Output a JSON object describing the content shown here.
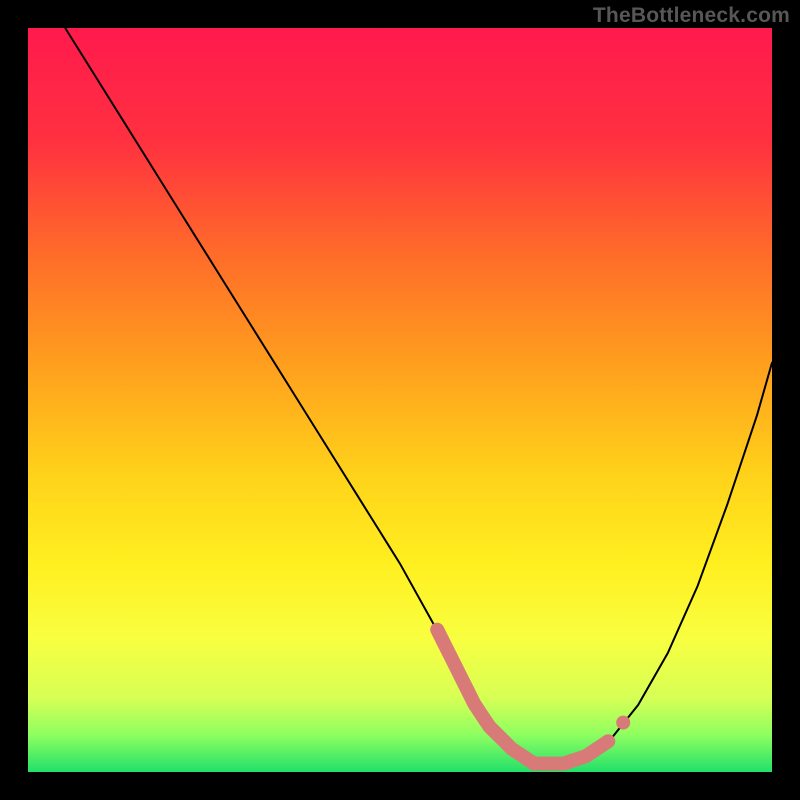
{
  "watermark": {
    "text": "TheBottleneck.com"
  },
  "chart_data": {
    "type": "line",
    "title": "",
    "xlabel": "",
    "ylabel": "",
    "xlim": [
      0,
      100
    ],
    "ylim": [
      0,
      100
    ],
    "grid": false,
    "legend": false,
    "series": [
      {
        "name": "bottleneck-curve",
        "x": [
          0,
          5,
          10,
          15,
          20,
          25,
          30,
          35,
          40,
          45,
          50,
          55,
          58,
          60,
          62,
          65,
          68,
          70,
          72,
          75,
          78,
          82,
          86,
          90,
          94,
          98,
          100
        ],
        "values": [
          108,
          100,
          92,
          84,
          76,
          68,
          60,
          52,
          44,
          36,
          28,
          19,
          13,
          9,
          6,
          3,
          1,
          1,
          1,
          2,
          4,
          9,
          16,
          25,
          36,
          48,
          55
        ],
        "color": "#000000"
      }
    ],
    "marker_band": {
      "comment": "thick pink band tracing the valley floor",
      "color": "#d87a78",
      "x_start": 55,
      "x_end": 78,
      "approx_y": 2,
      "detached_marker_x": 80
    },
    "background_gradient": {
      "stops": [
        {
          "pos": 0.0,
          "color": "#ff1a4d"
        },
        {
          "pos": 0.15,
          "color": "#ff3040"
        },
        {
          "pos": 0.3,
          "color": "#ff6a2a"
        },
        {
          "pos": 0.45,
          "color": "#ff9e1e"
        },
        {
          "pos": 0.6,
          "color": "#ffd21a"
        },
        {
          "pos": 0.72,
          "color": "#ffef20"
        },
        {
          "pos": 0.82,
          "color": "#f8ff40"
        },
        {
          "pos": 0.9,
          "color": "#d7ff55"
        },
        {
          "pos": 0.95,
          "color": "#8eff60"
        },
        {
          "pos": 1.0,
          "color": "#22e06a"
        }
      ]
    }
  }
}
